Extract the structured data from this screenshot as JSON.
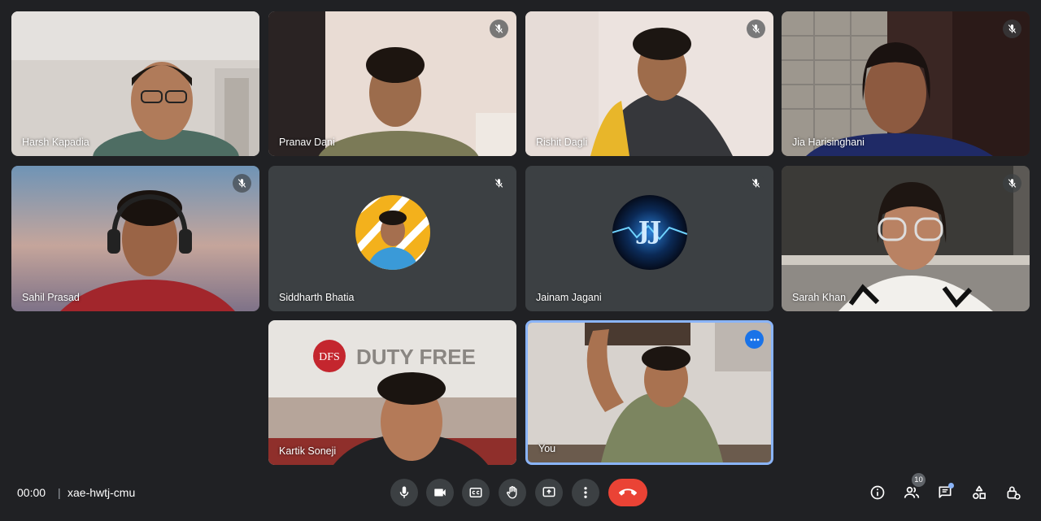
{
  "participants": [
    {
      "name": "Harsh Kapadia",
      "muted": false
    },
    {
      "name": "Pranav Dani",
      "muted": true
    },
    {
      "name": "Rishit Dagli",
      "muted": true
    },
    {
      "name": "Jia Harisinghani",
      "muted": true
    },
    {
      "name": "Sahil Prasad",
      "muted": true
    },
    {
      "name": "Siddharth Bhatia",
      "muted": true
    },
    {
      "name": "Jainam Jagani",
      "muted": true
    },
    {
      "name": "Sarah Khan",
      "muted": true
    },
    {
      "name": "Kartik Soneji",
      "muted": false
    },
    {
      "name": "You",
      "muted": false
    }
  ],
  "avatars": {
    "jainam_initials": "JJ"
  },
  "backgrounds": {
    "kartik_sign_brand": "DFS",
    "kartik_sign_text": "DUTY FREE"
  },
  "meeting": {
    "time": "00:00",
    "separator": "|",
    "code": "xae-hwtj-cmu",
    "participant_count": "10"
  },
  "controls": [
    {
      "name": "microphone-icon"
    },
    {
      "name": "camera-icon"
    },
    {
      "name": "captions-icon"
    },
    {
      "name": "raise-hand-icon"
    },
    {
      "name": "present-screen-icon"
    },
    {
      "name": "more-options-icon"
    },
    {
      "name": "hang-up-icon"
    }
  ],
  "side_actions": [
    {
      "name": "meeting-info-icon"
    },
    {
      "name": "people-icon"
    },
    {
      "name": "chat-icon"
    },
    {
      "name": "activities-icon"
    },
    {
      "name": "host-controls-icon"
    }
  ],
  "colors": {
    "background": "#202124",
    "control": "#3c4043",
    "hangup": "#ea4335",
    "active_speaker_border": "#8ab4f8",
    "accent": "#1a73e8"
  }
}
